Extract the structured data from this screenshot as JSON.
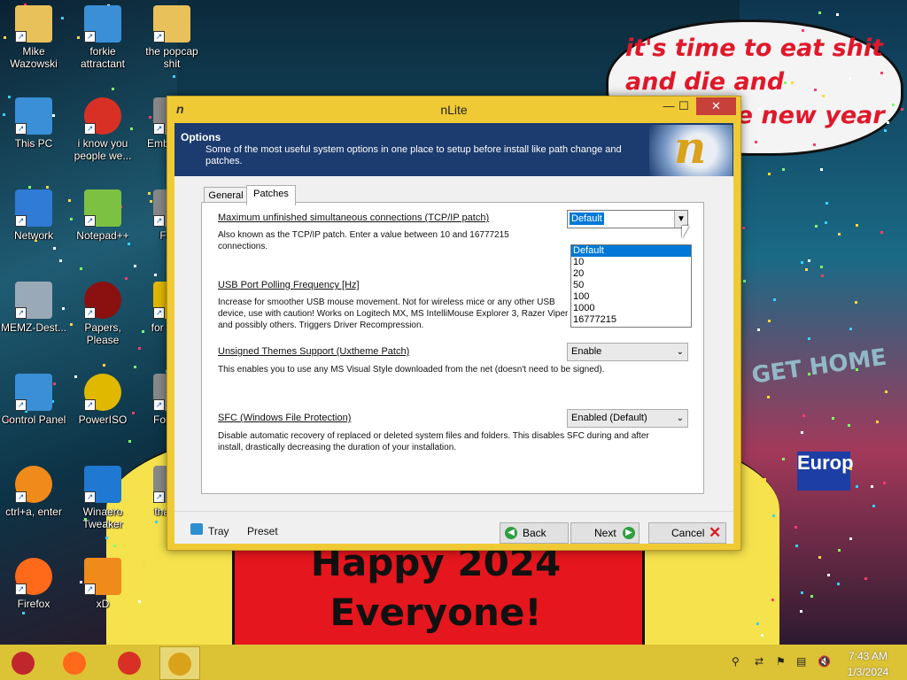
{
  "wallpaper": {
    "bubble_text": "it's time to eat shit and die and celebrate new year",
    "banner_text": "Happy 2024 Everyone!",
    "sign_text": "GET HOME",
    "sign2_text": "Europ"
  },
  "desktop_icons": [
    {
      "label": "Mike Wazowski",
      "icon": "folder-icon",
      "color": "#e8c15a"
    },
    {
      "label": "forkie attractant",
      "icon": "settings-monitor-icon",
      "color": "#3a8fd6"
    },
    {
      "label": "the popcap shit",
      "icon": "folder-icon",
      "color": "#e8c15a"
    },
    {
      "label": "This PC",
      "icon": "computer-icon",
      "color": "#3a8fd6"
    },
    {
      "label": "i know you people we...",
      "icon": "chrome-icon",
      "color": "#d93025"
    },
    {
      "label": "Emba Dev",
      "icon": "app-icon",
      "color": "#888888"
    },
    {
      "label": "Network",
      "icon": "network-icon",
      "color": "#2f7bd6"
    },
    {
      "label": "Notepad++",
      "icon": "notepadpp-icon",
      "color": "#7cc142"
    },
    {
      "label": "Fnde",
      "icon": "app-icon",
      "color": "#888888"
    },
    {
      "label": "MEMZ-Dest...",
      "icon": "recycle-bin-icon",
      "color": "#9aa9b8"
    },
    {
      "label": "Papers, Please",
      "icon": "papers-please-icon",
      "color": "#8b1010"
    },
    {
      "label": "for some",
      "icon": "app-icon",
      "color": "#e0b800"
    },
    {
      "label": "Control Panel",
      "icon": "control-panel-icon",
      "color": "#3a8fd6"
    },
    {
      "label": "PowerISO",
      "icon": "poweriso-icon",
      "color": "#e0b800"
    },
    {
      "label": "Forza S",
      "icon": "app-icon",
      "color": "#888888"
    },
    {
      "label": "ctrl+a, enter",
      "icon": "ring-icon",
      "color": "#f08a1a"
    },
    {
      "label": "Winaero Tweaker",
      "icon": "winaero-icon",
      "color": "#1f78d1"
    },
    {
      "label": "that b it",
      "icon": "app-icon",
      "color": "#888888"
    },
    {
      "label": "Firefox",
      "icon": "firefox-icon",
      "color": "#ff6a1a"
    },
    {
      "label": "xD",
      "icon": "hxd-icon",
      "color": "#f08a1a"
    }
  ],
  "window": {
    "title": "nLite",
    "minimize": "—",
    "maximize": "☐",
    "close": "✕",
    "header": {
      "title": "Options",
      "description": "Some of the most useful system options in one place to setup before install like path change and patches."
    },
    "tabs": [
      {
        "label": "General",
        "active": false
      },
      {
        "label": "Patches",
        "active": true
      }
    ],
    "options": [
      {
        "title": "Maximum unfinished simultaneous connections (TCP/IP patch)",
        "description": "Also known as the TCP/IP patch. Enter a value between 10 and 16777215 connections.",
        "value": "Default"
      },
      {
        "title": "USB Port Polling Frequency [Hz]",
        "description": "Increase for smoother USB mouse movement. Not for wireless mice or any other USB device, use with caution! Works on Logitech MX, MS IntelliMouse Explorer 3, Razer Viper and possibly others. Triggers Driver Recompression.",
        "value": ""
      },
      {
        "title": "Unsigned Themes Support (Uxtheme Patch)",
        "description": "This enables you to use any MS Visual Style downloaded from the net (doesn't need to be signed).",
        "value": "Enable"
      },
      {
        "title": "SFC (Windows File Protection)",
        "description": "Disable automatic recovery of replaced or deleted system files and folders. This disables SFC during and after install, drastically decreasing the duration of your installation.",
        "value": "Enabled (Default)"
      }
    ],
    "dropdown_options": [
      "Default",
      "10",
      "20",
      "50",
      "100",
      "1000",
      "16777215"
    ],
    "dropdown_selected": "Default",
    "footer": {
      "tray": "Tray",
      "preset": "Preset",
      "back": "Back",
      "next": "Next",
      "cancel": "Cancel"
    }
  },
  "taskbar": {
    "items": [
      {
        "icon": "start-ornament-icon",
        "color": "#c0272d"
      },
      {
        "icon": "firefox-icon",
        "color": "#ff6a1a"
      },
      {
        "icon": "chrome-icon",
        "color": "#d93025"
      },
      {
        "icon": "nlite-icon",
        "color": "#d9a21a"
      }
    ],
    "time": "7:43 AM",
    "date": "1/3/2024"
  }
}
